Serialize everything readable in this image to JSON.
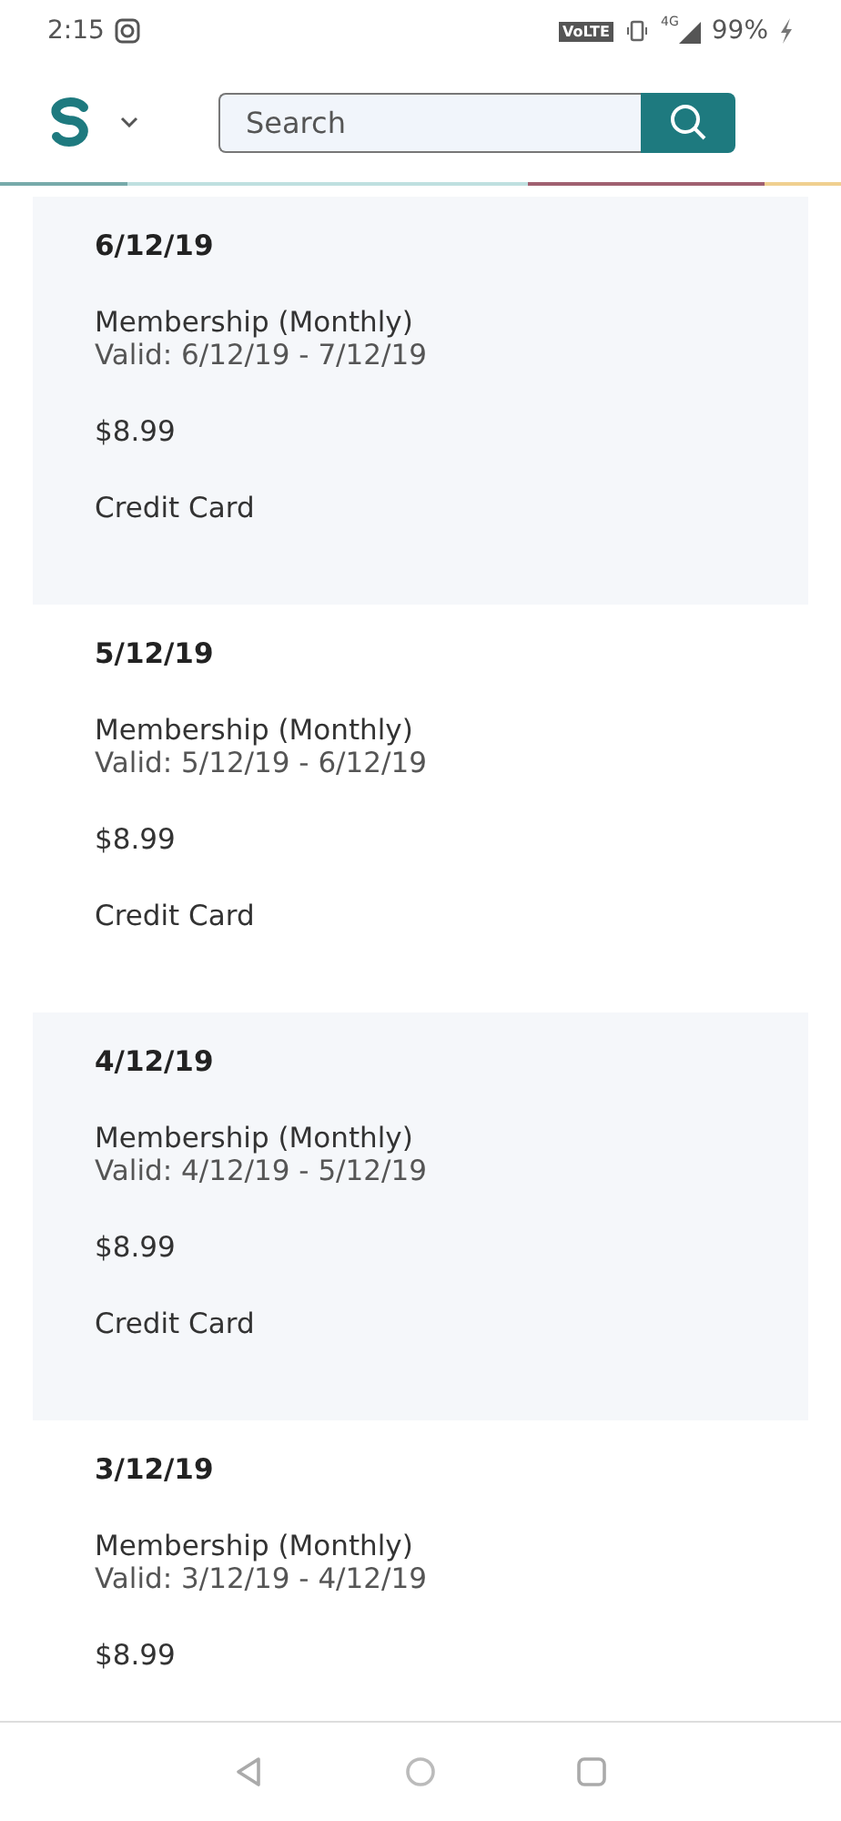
{
  "status_bar": {
    "time": "2:15",
    "volte": "VoLTE",
    "network": "4G",
    "battery": "99%"
  },
  "header": {
    "search": {
      "placeholder": "Search"
    }
  },
  "payments": [
    {
      "date": "6/12/19",
      "plan": "Membership (Monthly)",
      "valid": "Valid: 6/12/19 - 7/12/19",
      "amount": "$8.99",
      "method": "Credit Card"
    },
    {
      "date": "5/12/19",
      "plan": "Membership (Monthly)",
      "valid": "Valid: 5/12/19 - 6/12/19",
      "amount": "$8.99",
      "method": "Credit Card"
    },
    {
      "date": "4/12/19",
      "plan": "Membership (Monthly)",
      "valid": "Valid: 4/12/19 - 5/12/19",
      "amount": "$8.99",
      "method": "Credit Card"
    },
    {
      "date": "3/12/19",
      "plan": "Membership (Monthly)",
      "valid": "Valid: 3/12/19 - 4/12/19",
      "amount": "$8.99"
    }
  ]
}
